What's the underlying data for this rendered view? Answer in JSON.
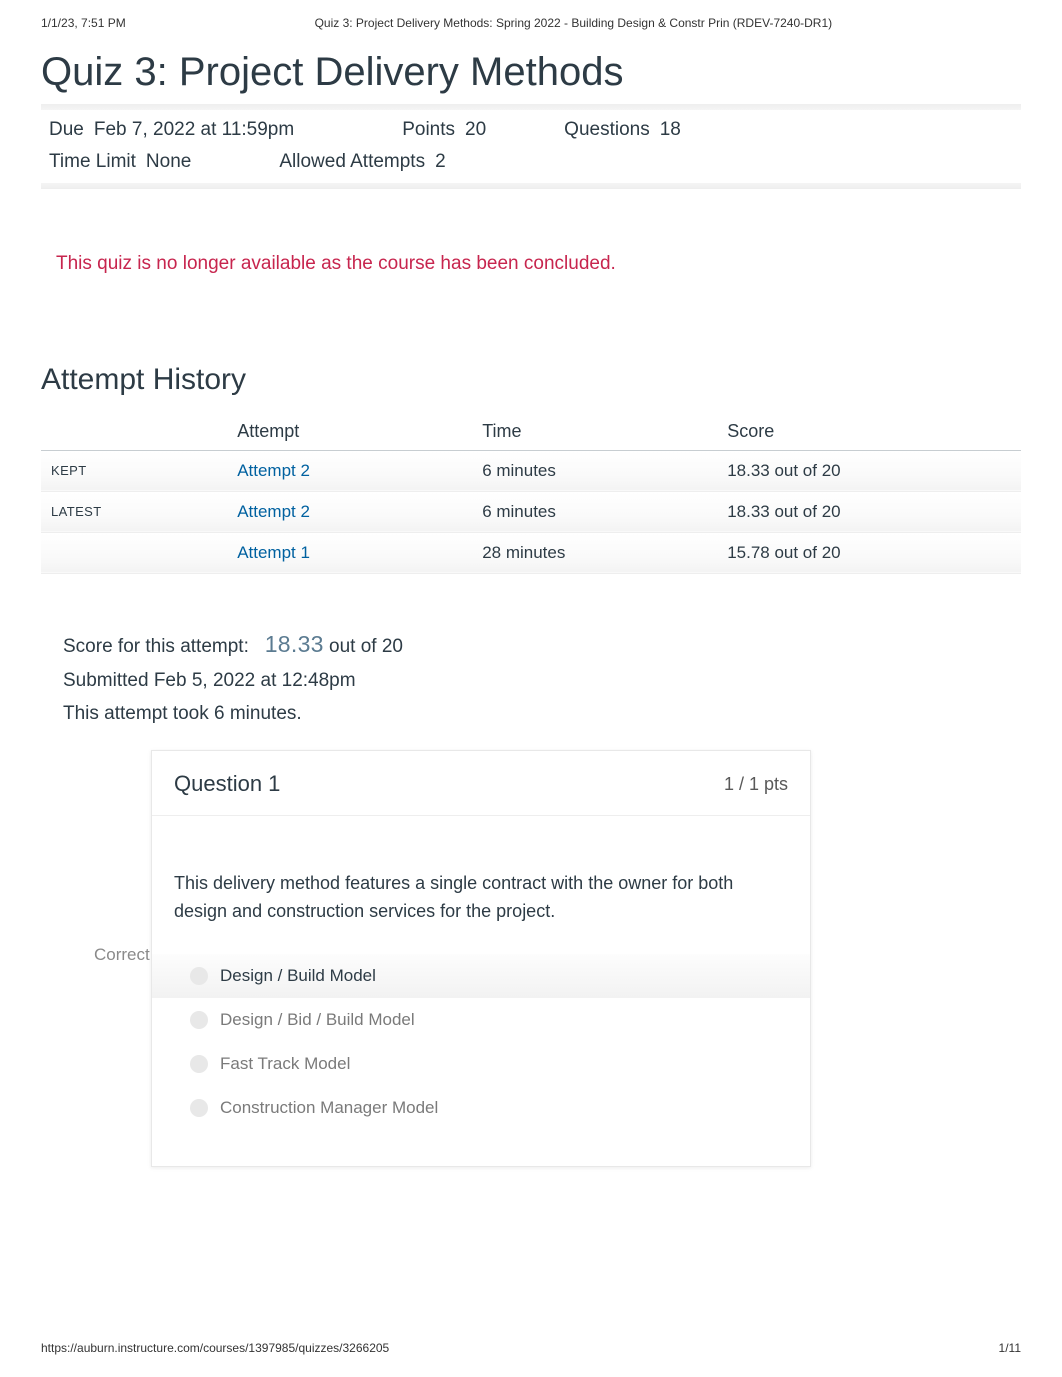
{
  "print": {
    "timestamp": "1/1/23, 7:51 PM",
    "doc_title": "Quiz 3: Project Delivery Methods: Spring 2022 - Building Design & Constr Prin (RDEV-7240-DR1)",
    "footer_url": "https://auburn.instructure.com/courses/1397985/quizzes/3266205",
    "page_indicator": "1/11"
  },
  "quiz": {
    "title": "Quiz 3: Project Delivery Methods",
    "meta": [
      {
        "label": "Due",
        "value": "Feb 7, 2022 at 11:59pm"
      },
      {
        "label": "Points",
        "value": "20"
      },
      {
        "label": "Questions",
        "value": "18"
      },
      {
        "label": "Time Limit",
        "value": "None"
      },
      {
        "label": "Allowed Attempts",
        "value": "2"
      }
    ],
    "notice": "This quiz is no longer available as the course has been concluded."
  },
  "attempt_history": {
    "heading": "Attempt History",
    "columns": [
      "",
      "Attempt",
      "Time",
      "Score"
    ],
    "rows": [
      {
        "status": "KEPT",
        "attempt_label": "Attempt 2",
        "time": "6 minutes",
        "score": "18.33 out of 20"
      },
      {
        "status": "LATEST",
        "attempt_label": "Attempt 2",
        "time": "6 minutes",
        "score": "18.33 out of 20"
      },
      {
        "status": "",
        "attempt_label": "Attempt 1",
        "time": "28 minutes",
        "score": "15.78 out of 20"
      }
    ]
  },
  "summary": {
    "score_label": "Score for this attempt:",
    "score_value": "18.33",
    "score_suffix": " out of 20",
    "submitted": "Submitted Feb 5, 2022 at 12:48pm",
    "duration": "This attempt took 6 minutes."
  },
  "question": {
    "correct_label": "Correct!",
    "title": "Question 1",
    "points": "1 / 1 pts",
    "prompt": "This delivery method features a single contract with the owner for both design and construction services for the project.",
    "answers": [
      {
        "text": "Design / Build Model",
        "selected": true
      },
      {
        "text": "Design / Bid / Build Model",
        "selected": false
      },
      {
        "text": "Fast Track Model",
        "selected": false
      },
      {
        "text": "Construction Manager Model",
        "selected": false
      }
    ]
  }
}
